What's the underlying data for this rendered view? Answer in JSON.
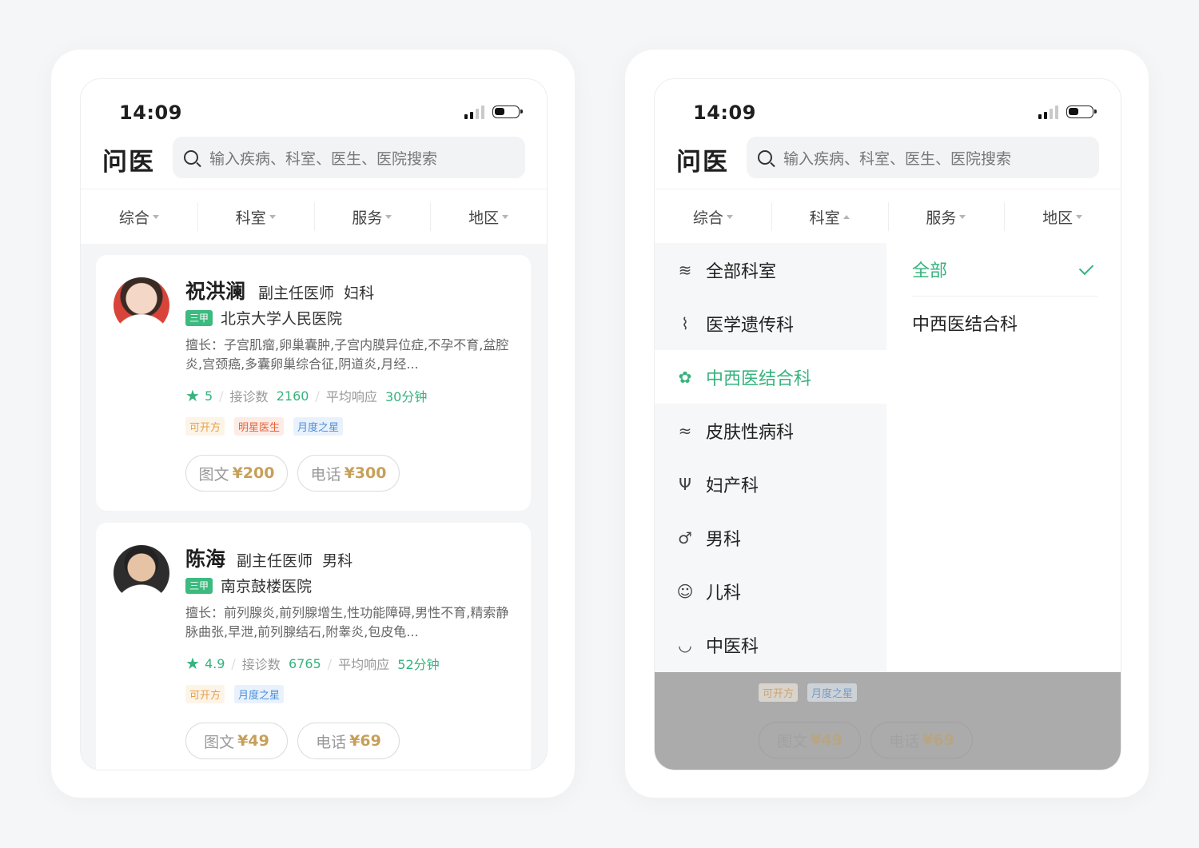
{
  "status": {
    "time": "14:09"
  },
  "header": {
    "title": "问医",
    "search_placeholder": "输入疾病、科室、医生、医院搜索"
  },
  "filters": [
    "综合",
    "科室",
    "服务",
    "地区"
  ],
  "doctors": [
    {
      "name": "祝洪澜",
      "title": "副主任医师",
      "dept": "妇科",
      "grade": "三甲",
      "hospital": "北京大学人民医院",
      "skill": "擅长：子宫肌瘤,卵巢囊肿,子宫内膜异位症,不孕不育,盆腔炎,宫颈癌,多囊卵巢综合征,阴道炎,月经...",
      "rating": "5",
      "consult_label": "接诊数",
      "consult_count": "2160",
      "response_label": "平均响应",
      "response_time": "30分钟",
      "tags": [
        "可开方",
        "明星医生",
        "月度之星"
      ],
      "services": [
        {
          "label": "图文",
          "price": "¥200"
        },
        {
          "label": "电话",
          "price": "¥300"
        }
      ]
    },
    {
      "name": "陈海",
      "title": "副主任医师",
      "dept": "男科",
      "grade": "三甲",
      "hospital": "南京鼓楼医院",
      "skill": "擅长：前列腺炎,前列腺增生,性功能障碍,男性不育,精索静脉曲张,早泄,前列腺结石,附睾炎,包皮龟...",
      "rating": "4.9",
      "consult_label": "接诊数",
      "consult_count": "6765",
      "response_label": "平均响应",
      "response_time": "52分钟",
      "tags": [
        "可开方",
        "月度之星"
      ],
      "services": [
        {
          "label": "图文",
          "price": "¥49"
        },
        {
          "label": "电话",
          "price": "¥69"
        }
      ]
    }
  ],
  "departments": [
    {
      "label": "全部科室",
      "icon": "layers-icon"
    },
    {
      "label": "医学遗传科",
      "icon": "dna-icon"
    },
    {
      "label": "中西医结合科",
      "icon": "herb-icon",
      "active": true
    },
    {
      "label": "皮肤性病科",
      "icon": "skin-icon"
    },
    {
      "label": "妇产科",
      "icon": "uterus-icon"
    },
    {
      "label": "男科",
      "icon": "male-icon"
    },
    {
      "label": "儿科",
      "icon": "baby-face-icon"
    },
    {
      "label": "中医科",
      "icon": "mortar-icon"
    }
  ],
  "sub_departments": [
    {
      "label": "全部",
      "selected": true
    },
    {
      "label": "中西医结合科"
    }
  ],
  "colors": {
    "accent": "#36b37e",
    "price": "#c6a05a",
    "grade_badge": "#3dba7f"
  }
}
